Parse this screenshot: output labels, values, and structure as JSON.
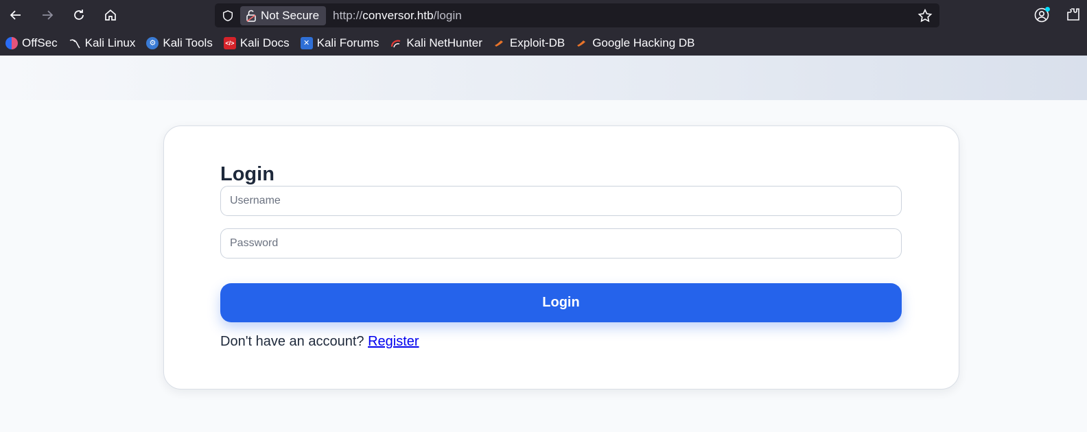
{
  "browser": {
    "security_label": "Not Secure",
    "url_scheme": "http://",
    "url_host": "conversor.htb",
    "url_path": "/login",
    "bookmarks": [
      {
        "label": "OffSec",
        "icon": "offsec-icon"
      },
      {
        "label": "Kali Linux",
        "icon": "kali-dragon-icon"
      },
      {
        "label": "Kali Tools",
        "icon": "kali-tools-icon"
      },
      {
        "label": "Kali Docs",
        "icon": "kali-docs-icon"
      },
      {
        "label": "Kali Forums",
        "icon": "kali-forums-icon"
      },
      {
        "label": "Kali NetHunter",
        "icon": "kali-nethunter-icon"
      },
      {
        "label": "Exploit-DB",
        "icon": "exploit-db-icon"
      },
      {
        "label": "Google Hacking DB",
        "icon": "ghdb-icon"
      }
    ]
  },
  "login": {
    "title": "Login",
    "username_placeholder": "Username",
    "password_placeholder": "Password",
    "submit_label": "Login",
    "no_account_text": "Don't have an account? ",
    "register_link": "Register"
  },
  "colors": {
    "chrome_bg": "#2b2a33",
    "urlbar_bg": "#1c1b22",
    "primary_button": "#2563eb",
    "link": "#0000ee"
  }
}
